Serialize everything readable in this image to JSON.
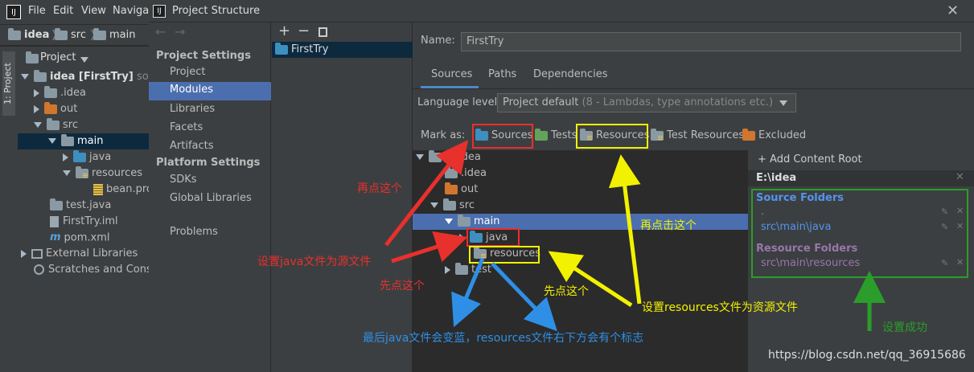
{
  "ide": {
    "logo": "IJ",
    "menu": [
      "File",
      "Edit",
      "View",
      "Navigat"
    ],
    "breadcrumb": [
      "idea",
      "src",
      "main"
    ],
    "side_tab": "1: Project",
    "project_header": "Project",
    "tree": [
      {
        "label": "idea [FirstTry]",
        "suffix": "sourc",
        "icon": "folder"
      },
      {
        "label": ".idea",
        "icon": "folder"
      },
      {
        "label": "out",
        "icon": "folder-orange"
      },
      {
        "label": "src",
        "icon": "folder"
      },
      {
        "label": "main",
        "icon": "folder"
      },
      {
        "label": "java",
        "icon": "folder-blue"
      },
      {
        "label": "resources",
        "icon": "folder-resources"
      },
      {
        "label": "bean.pro",
        "icon": "file"
      },
      {
        "label": "test.java",
        "icon": "file"
      },
      {
        "label": "FirstTry.iml",
        "icon": "file"
      },
      {
        "label": "pom.xml",
        "icon": "maven"
      },
      {
        "label": "External Libraries",
        "icon": "library"
      },
      {
        "label": "Scratches and Conso",
        "icon": "scratch"
      }
    ]
  },
  "dialog": {
    "title": "Project Structure",
    "nav": {
      "project_settings": "Project Settings",
      "project_settings_items": [
        "Project",
        "Modules",
        "Libraries",
        "Facets",
        "Artifacts"
      ],
      "platform_settings": "Platform Settings",
      "platform_settings_items": [
        "SDKs",
        "Global Libraries"
      ],
      "problems": "Problems"
    },
    "modules": [
      "FirstTry"
    ],
    "name_label": "Name:",
    "name_value": "FirstTry",
    "tabs": [
      "Sources",
      "Paths",
      "Dependencies"
    ],
    "language_level_label": "Language level:",
    "language_level_value": "Project default",
    "language_level_hint": "(8 - Lambdas, type annotations etc.)",
    "mark_as_label": "Mark as:",
    "mark_as": [
      "Sources",
      "Tests",
      "Resources",
      "Test Resources",
      "Excluded"
    ],
    "content_tree": [
      {
        "label": "E:\\idea"
      },
      {
        "label": ".idea"
      },
      {
        "label": "out"
      },
      {
        "label": "src"
      },
      {
        "label": "main"
      },
      {
        "label": "java"
      },
      {
        "label": "resources"
      },
      {
        "label": "test"
      }
    ],
    "add_content_root": "+ Add Content Root",
    "content_root": "E:\\idea",
    "source_folders_label": "Source Folders",
    "source_folders": [
      ".",
      "src\\main\\java"
    ],
    "resource_folders_label": "Resource Folders",
    "resource_folders": [
      "src\\main\\resources"
    ]
  },
  "annotations": {
    "click_again": "再点这个",
    "click_again_2": "再点击这个",
    "set_java_source": "设置java文件为源文件",
    "click_first_red": "先点这个",
    "click_first_yellow": "先点这个",
    "set_resources": "设置resources文件为资源文件",
    "finally_blue": "最后java文件会变蓝，resources文件右下方会有个标志",
    "success": "设置成功"
  },
  "watermark": "https://blog.csdn.net/qq_36915686",
  "colors": {
    "red": "#e8302c",
    "yellow": "#f2f200",
    "blue": "#2f8fe6",
    "green": "#2a9d2a",
    "selection": "#4b6eaf",
    "source_blue": "#5394ec",
    "resource_purple": "#9876aa"
  }
}
